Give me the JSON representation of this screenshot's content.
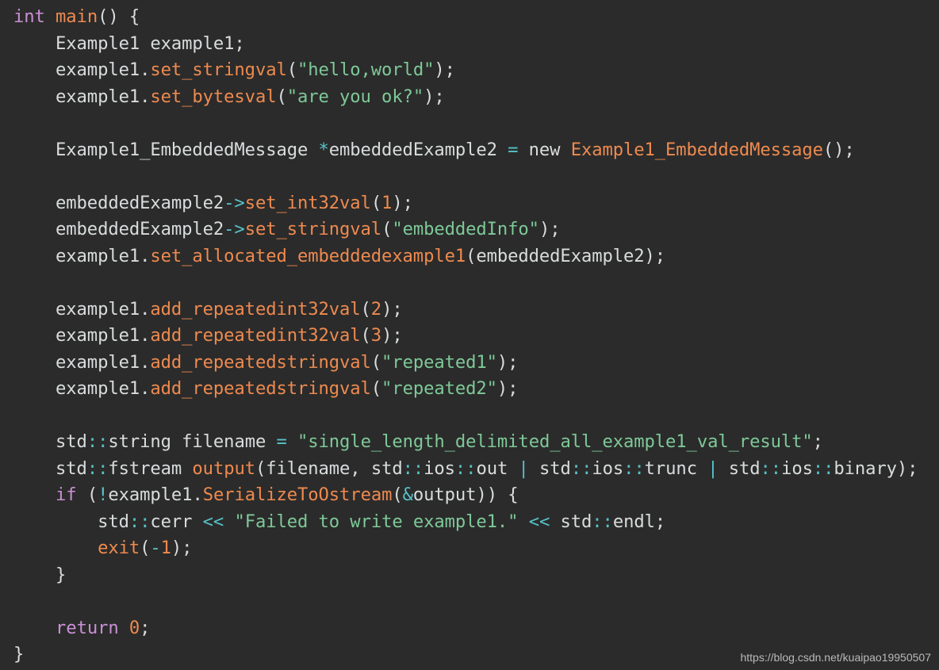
{
  "editor": {
    "language": "cpp",
    "lines": [
      [
        [
          "kw",
          "int"
        ],
        [
          "plain",
          " "
        ],
        [
          "fn",
          "main"
        ],
        [
          "plain",
          "() {"
        ]
      ],
      [
        [
          "plain",
          "    Example1 example1;"
        ]
      ],
      [
        [
          "plain",
          "    example1."
        ],
        [
          "fn",
          "set_stringval"
        ],
        [
          "plain",
          "("
        ],
        [
          "str",
          "\"hello,world\""
        ],
        [
          "plain",
          ");"
        ]
      ],
      [
        [
          "plain",
          "    example1."
        ],
        [
          "fn",
          "set_bytesval"
        ],
        [
          "plain",
          "("
        ],
        [
          "str",
          "\"are you ok?\""
        ],
        [
          "plain",
          ");"
        ]
      ],
      [],
      [
        [
          "plain",
          "    Example1_EmbeddedMessage "
        ],
        [
          "op",
          "*"
        ],
        [
          "plain",
          "embeddedExample2 "
        ],
        [
          "op",
          "="
        ],
        [
          "plain",
          " new "
        ],
        [
          "fn",
          "Example1_EmbeddedMessage"
        ],
        [
          "plain",
          "();"
        ]
      ],
      [],
      [
        [
          "plain",
          "    embeddedExample2"
        ],
        [
          "op",
          "->"
        ],
        [
          "fn",
          "set_int32val"
        ],
        [
          "plain",
          "("
        ],
        [
          "num",
          "1"
        ],
        [
          "plain",
          ");"
        ]
      ],
      [
        [
          "plain",
          "    embeddedExample2"
        ],
        [
          "op",
          "->"
        ],
        [
          "fn",
          "set_stringval"
        ],
        [
          "plain",
          "("
        ],
        [
          "str",
          "\"embeddedInfo\""
        ],
        [
          "plain",
          ");"
        ]
      ],
      [
        [
          "plain",
          "    example1."
        ],
        [
          "fn",
          "set_allocated_embeddedexample1"
        ],
        [
          "plain",
          "(embeddedExample2);"
        ]
      ],
      [],
      [
        [
          "plain",
          "    example1."
        ],
        [
          "fn",
          "add_repeatedint32val"
        ],
        [
          "plain",
          "("
        ],
        [
          "num",
          "2"
        ],
        [
          "plain",
          ");"
        ]
      ],
      [
        [
          "plain",
          "    example1."
        ],
        [
          "fn",
          "add_repeatedint32val"
        ],
        [
          "plain",
          "("
        ],
        [
          "num",
          "3"
        ],
        [
          "plain",
          ");"
        ]
      ],
      [
        [
          "plain",
          "    example1."
        ],
        [
          "fn",
          "add_repeatedstringval"
        ],
        [
          "plain",
          "("
        ],
        [
          "str",
          "\"repeated1\""
        ],
        [
          "plain",
          ");"
        ]
      ],
      [
        [
          "plain",
          "    example1."
        ],
        [
          "fn",
          "add_repeatedstringval"
        ],
        [
          "plain",
          "("
        ],
        [
          "str",
          "\"repeated2\""
        ],
        [
          "plain",
          ");"
        ]
      ],
      [],
      [
        [
          "plain",
          "    std"
        ],
        [
          "op",
          "::"
        ],
        [
          "plain",
          "string filename "
        ],
        [
          "op",
          "="
        ],
        [
          "plain",
          " "
        ],
        [
          "str",
          "\"single_length_delimited_all_example1_val_result\""
        ],
        [
          "plain",
          ";"
        ]
      ],
      [
        [
          "plain",
          "    std"
        ],
        [
          "op",
          "::"
        ],
        [
          "plain",
          "fstream "
        ],
        [
          "fn",
          "output"
        ],
        [
          "plain",
          "(filename, std"
        ],
        [
          "op",
          "::"
        ],
        [
          "plain",
          "ios"
        ],
        [
          "op",
          "::"
        ],
        [
          "plain",
          "out "
        ],
        [
          "op",
          "|"
        ],
        [
          "plain",
          " std"
        ],
        [
          "op",
          "::"
        ],
        [
          "plain",
          "ios"
        ],
        [
          "op",
          "::"
        ],
        [
          "plain",
          "trunc "
        ],
        [
          "op",
          "|"
        ],
        [
          "plain",
          " std"
        ],
        [
          "op",
          "::"
        ],
        [
          "plain",
          "ios"
        ],
        [
          "op",
          "::"
        ],
        [
          "plain",
          "binary);"
        ]
      ],
      [
        [
          "plain",
          "    "
        ],
        [
          "kw",
          "if"
        ],
        [
          "plain",
          " ("
        ],
        [
          "op",
          "!"
        ],
        [
          "plain",
          "example1."
        ],
        [
          "fn",
          "SerializeToOstream"
        ],
        [
          "plain",
          "("
        ],
        [
          "op",
          "&"
        ],
        [
          "plain",
          "output)) {"
        ]
      ],
      [
        [
          "plain",
          "        std"
        ],
        [
          "op",
          "::"
        ],
        [
          "plain",
          "cerr "
        ],
        [
          "op",
          "<<"
        ],
        [
          "plain",
          " "
        ],
        [
          "str",
          "\"Failed to write example1.\""
        ],
        [
          "plain",
          " "
        ],
        [
          "op",
          "<<"
        ],
        [
          "plain",
          " std"
        ],
        [
          "op",
          "::"
        ],
        [
          "plain",
          "endl;"
        ]
      ],
      [
        [
          "plain",
          "        "
        ],
        [
          "fn",
          "exit"
        ],
        [
          "plain",
          "("
        ],
        [
          "op",
          "-"
        ],
        [
          "num",
          "1"
        ],
        [
          "plain",
          ");"
        ]
      ],
      [
        [
          "plain",
          "    }"
        ]
      ],
      [],
      [
        [
          "plain",
          "    "
        ],
        [
          "kw",
          "return"
        ],
        [
          "plain",
          " "
        ],
        [
          "num",
          "0"
        ],
        [
          "plain",
          ";"
        ]
      ],
      [
        [
          "plain",
          "}"
        ]
      ]
    ]
  },
  "watermark": {
    "text": "https://blog.csdn.net/kuaipao19950507"
  },
  "colors": {
    "background": "#2b2b2b",
    "keyword": "#c990d4",
    "function": "#ee8a4f",
    "string": "#7ec998",
    "operator": "#56c3c8",
    "number": "#ee8a4f",
    "plain": "#d9dcdd"
  }
}
